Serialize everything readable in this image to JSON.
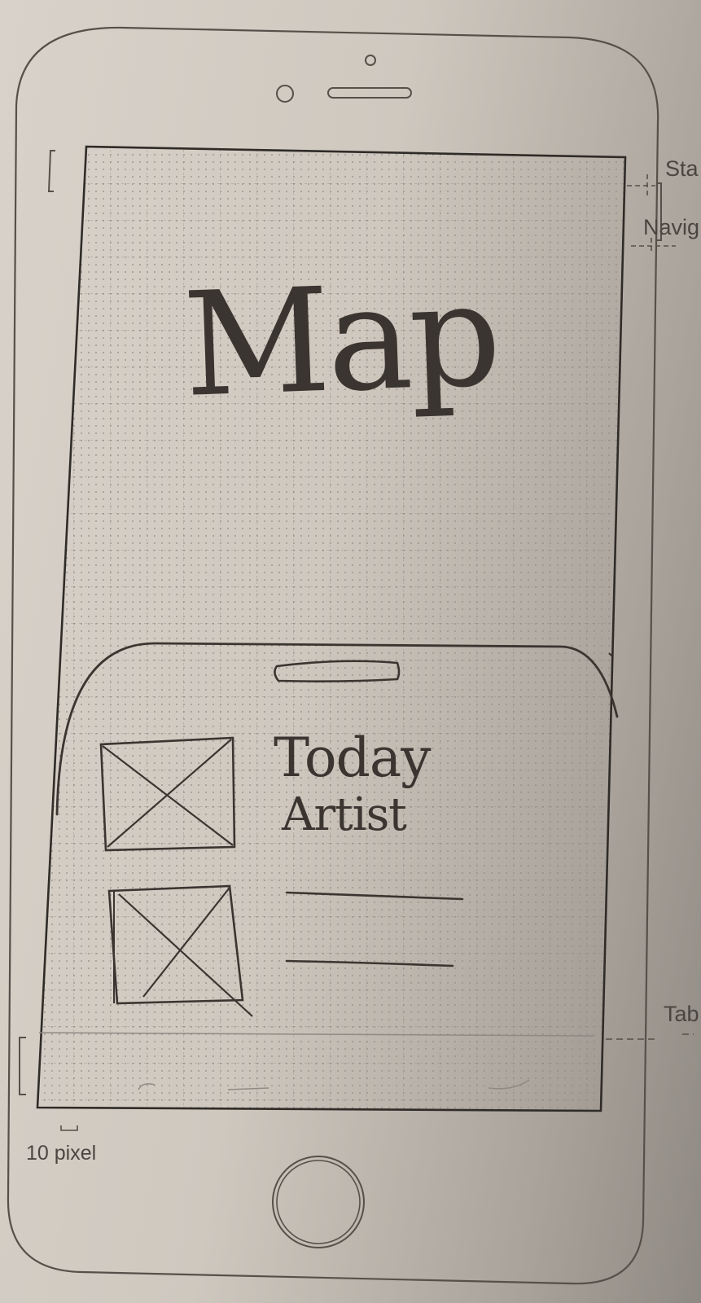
{
  "screen": {
    "map_label": "Map",
    "bottom_sheet": {
      "items": [
        {
          "line1": "Today",
          "line2": "Artist"
        },
        {
          "line1": "",
          "line2": ""
        }
      ]
    }
  },
  "template_labels": {
    "status_bar": "Sta",
    "navigation_bar": "Navig",
    "tab_bar": "Tab",
    "margin_note": "10 pixel"
  },
  "icons": [
    "front-camera-icon",
    "speaker-icon",
    "sensor-icon",
    "home-button-icon",
    "image-placeholder-icon"
  ],
  "colors": {
    "paper": "#d8d2ca",
    "ink": "#3a3530",
    "outline": "#555049",
    "grid": "#8f8a84"
  }
}
